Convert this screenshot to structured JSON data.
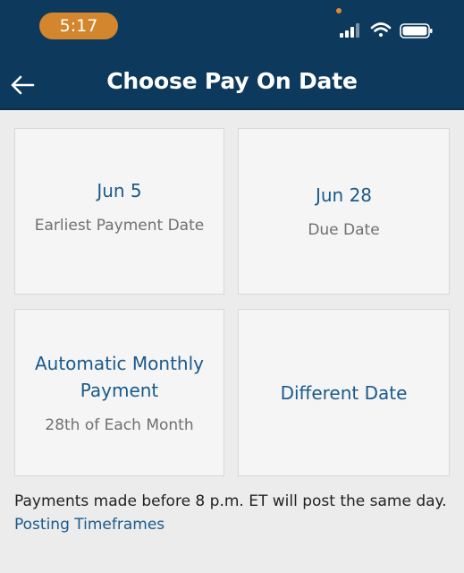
{
  "status_bar": {
    "time": "5:17",
    "icons": [
      "cellular-signal-icon",
      "wifi-icon",
      "battery-icon"
    ]
  },
  "header": {
    "title": "Choose Pay On Date",
    "back_icon": "back-arrow-icon"
  },
  "options": [
    {
      "title": "Jun 5",
      "subtitle": "Earliest Payment Date"
    },
    {
      "title": "Jun 28",
      "subtitle": "Due Date"
    },
    {
      "title": "Automatic Monthly Payment",
      "subtitle": "28th of Each Month"
    },
    {
      "title": "Different Date"
    }
  ],
  "footer": {
    "note": "Payments made before 8 p.m. ET will post the same day.",
    "link": "Posting Timeframes"
  },
  "colors": {
    "header_bg": "#0d3a5c",
    "time_pill": "#d4862e",
    "accent_text": "#1a5a8c",
    "page_bg": "#ececec"
  }
}
